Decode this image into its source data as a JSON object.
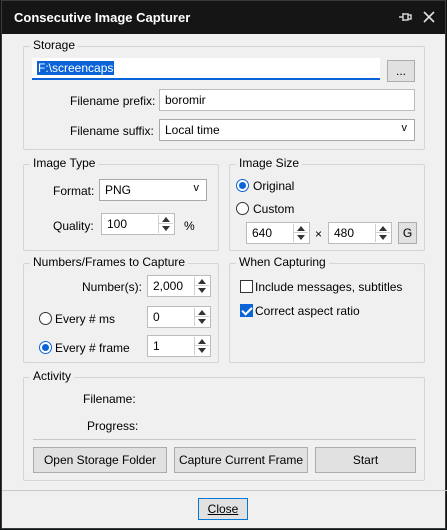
{
  "window": {
    "title": "Consecutive Image Capturer",
    "pin_icon": "pin-icon",
    "close_icon": "close-icon"
  },
  "storage": {
    "label": "Storage",
    "path": "F:\\screencaps",
    "browse_label": "...",
    "prefix_label": "Filename prefix:",
    "prefix_value": "boromir",
    "suffix_label": "Filename suffix:",
    "suffix_value": "Local time"
  },
  "image_type": {
    "label": "Image Type",
    "format_label": "Format:",
    "format_value": "PNG",
    "quality_label": "Quality:",
    "quality_value": "100",
    "quality_unit": "%"
  },
  "image_size": {
    "label": "Image Size",
    "original_label": "Original",
    "custom_label": "Custom",
    "selected": "Original",
    "width": "640",
    "times": "×",
    "height": "480",
    "g_label": "G"
  },
  "numbers": {
    "label": "Numbers/Frames to Capture",
    "number_label": "Number(s):",
    "number_value": "2,000",
    "every_ms_label": "Every # ms",
    "every_ms_value": "0",
    "every_frame_label": "Every # frame",
    "every_frame_value": "1",
    "selected": "Every # frame"
  },
  "when_capturing": {
    "label": "When Capturing",
    "include_messages_label": "Include messages, subtitles",
    "include_messages_checked": false,
    "correct_aspect_label": "Correct aspect ratio",
    "correct_aspect_checked": true
  },
  "activity": {
    "label": "Activity",
    "filename_label": "Filename:",
    "filename_value": "",
    "progress_label": "Progress:",
    "progress_value": ""
  },
  "actions": {
    "open_folder": "Open Storage Folder",
    "capture_frame": "Capture Current Frame",
    "start": "Start"
  },
  "footer": {
    "close": "Close"
  },
  "colors": {
    "accent": "#0a64d8",
    "titlebar": "#151515",
    "window_bg": "#f0f0f0"
  }
}
